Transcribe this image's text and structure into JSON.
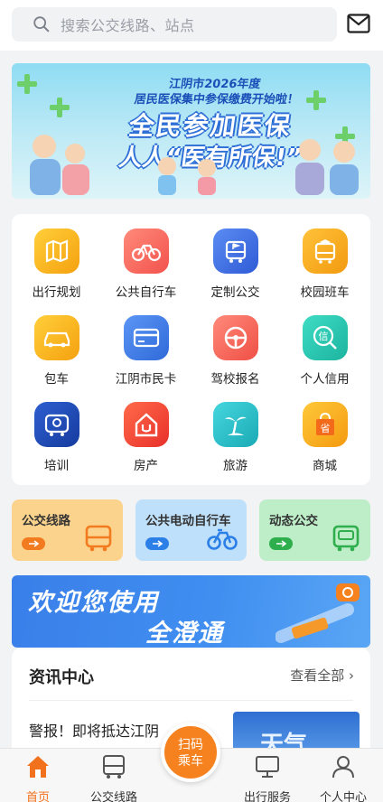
{
  "search": {
    "placeholder": "搜索公交线路、站点"
  },
  "icons": {
    "search": "search-icon",
    "mail": "mail-icon"
  },
  "banner": {
    "line1": "江阴市2026年度",
    "line2": "居民医保集中参保缴费开始啦！",
    "headline1": "全民参加医保",
    "headline2": "人人“医有所保!”"
  },
  "services": [
    {
      "label": "出行规划",
      "icon": "map-icon",
      "color": "#f7b21a"
    },
    {
      "label": "公共自行车",
      "icon": "bicycle-icon",
      "color": "#f46a6a"
    },
    {
      "label": "定制公交",
      "icon": "bus-flag-icon",
      "color": "#3f6fe0"
    },
    {
      "label": "校园班车",
      "icon": "school-bus-icon",
      "color": "#f5a419"
    },
    {
      "label": "包车",
      "icon": "car-icon",
      "color": "#f7b21a"
    },
    {
      "label": "江阴市民卡",
      "icon": "card-icon",
      "color": "#3f7ce8"
    },
    {
      "label": "驾校报名",
      "icon": "steering-wheel-icon",
      "color": "#f2665a"
    },
    {
      "label": "个人信用",
      "icon": "credit-icon",
      "color": "#2cc5b0"
    },
    {
      "label": "培训",
      "icon": "training-bus-icon",
      "color": "#1f4fb8"
    },
    {
      "label": "房产",
      "icon": "house-icon",
      "color": "#f2463a"
    },
    {
      "label": "旅游",
      "icon": "palm-tree-icon",
      "color": "#2dc1c9"
    },
    {
      "label": "商城",
      "icon": "shopping-bag-icon",
      "color": "#f7a21a"
    }
  ],
  "quick": [
    {
      "title": "公交线路",
      "icon": "bus-icon",
      "bg": "#fcd38c",
      "accent": "#f27a1f"
    },
    {
      "title": "公共电动自行车",
      "icon": "bicycle-icon",
      "bg": "#bfe0fb",
      "accent": "#2b7fe6"
    },
    {
      "title": "动态公交",
      "icon": "bus-signal-icon",
      "bg": "#bdeec8",
      "accent": "#2fae4e"
    }
  ],
  "promo": {
    "line1": "欢迎您使用",
    "line2": "全澄通"
  },
  "news": {
    "title": "资讯中心",
    "more": "查看全部",
    "item": "警报！即将抵达江阴",
    "thumb": "天气"
  },
  "scan": {
    "line1": "扫码",
    "line2": "乘车"
  },
  "tabs": [
    {
      "label": "首页",
      "icon": "home-icon",
      "active": true
    },
    {
      "label": "公交线路",
      "icon": "bus-icon",
      "active": false
    },
    {
      "label": "出行服务",
      "icon": "monitor-icon",
      "active": false
    },
    {
      "label": "个人中心",
      "icon": "person-icon",
      "active": false
    }
  ],
  "colors": {
    "brand": "#f5821f",
    "tab_active": "#f2711c"
  }
}
